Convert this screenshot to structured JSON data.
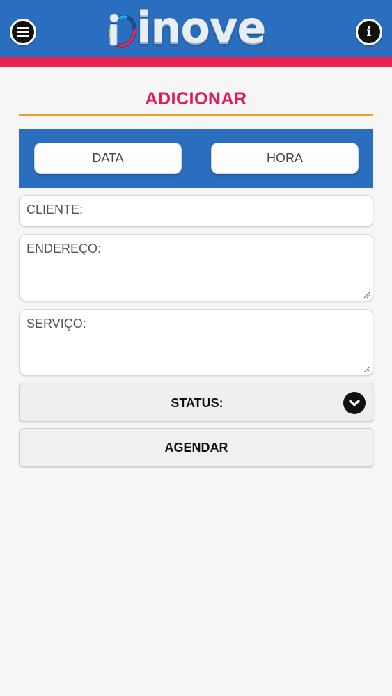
{
  "header": {
    "logo_text": "inove",
    "menu_icon": "hamburger-menu-icon",
    "info_icon": "info-icon",
    "colors": {
      "bar": "#2a6fbf",
      "stripe": "#e8234f"
    }
  },
  "page": {
    "title": "ADICIONAR",
    "title_color": "#e0185c",
    "rule_color": "#f0a020"
  },
  "datetime": {
    "date_label": "DATA",
    "time_label": "HORA"
  },
  "form": {
    "cliente_placeholder": "CLIENTE:",
    "endereco_placeholder": "ENDEREÇO:",
    "servico_placeholder": "SERVIÇO:",
    "status_label": "STATUS:",
    "status_icon": "chevron-down-icon",
    "submit_label": "AGENDAR"
  }
}
